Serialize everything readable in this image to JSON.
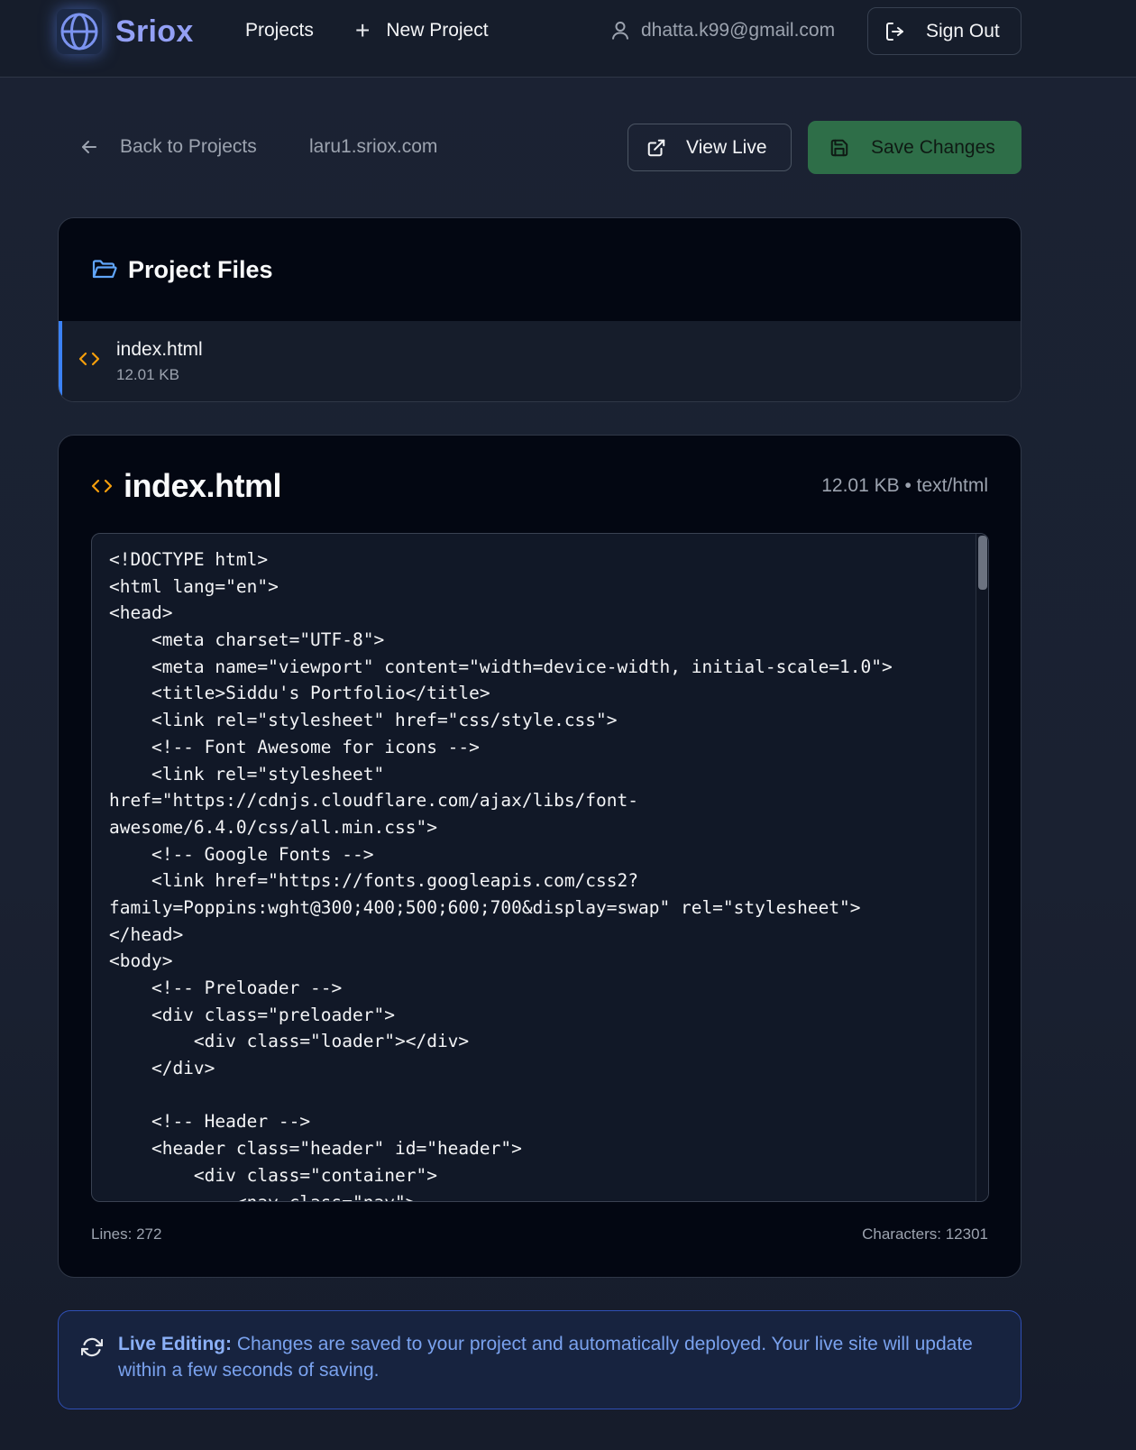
{
  "nav": {
    "brand": "Sriox",
    "projects_label": "Projects",
    "new_project_label": "New Project",
    "user_email": "dhatta.k99@gmail.com",
    "sign_out_label": "Sign Out"
  },
  "toolbar": {
    "back_label": "Back to Projects",
    "domain": "laru1.sriox.com",
    "view_live_label": "View Live",
    "save_label": "Save Changes"
  },
  "files": {
    "title": "Project Files",
    "items": [
      {
        "name": "index.html",
        "size": "12.01 KB",
        "selected": true
      }
    ]
  },
  "editor": {
    "filename": "index.html",
    "meta": "12.01 KB • text/html",
    "lines_label": "Lines: 272",
    "chars_label": "Characters: 12301",
    "scroll_fraction": 0.0,
    "code_lines": [
      "<!DOCTYPE html>",
      "<html lang=\"en\">",
      "<head>",
      "    <meta charset=\"UTF-8\">",
      "    <meta name=\"viewport\" content=\"width=device-width, initial-scale=1.0\">",
      "    <title>Siddu's Portfolio</title>",
      "    <link rel=\"stylesheet\" href=\"css/style.css\">",
      "    <!-- Font Awesome for icons -->",
      "    <link rel=\"stylesheet\"",
      "href=\"https://cdnjs.cloudflare.com/ajax/libs/font-",
      "awesome/6.4.0/css/all.min.css\">",
      "    <!-- Google Fonts -->",
      "    <link href=\"https://fonts.googleapis.com/css2?",
      "family=Poppins:wght@300;400;500;600;700&display=swap\" rel=\"stylesheet\">",
      "</head>",
      "<body>",
      "    <!-- Preloader -->",
      "    <div class=\"preloader\">",
      "        <div class=\"loader\"></div>",
      "    </div>",
      "",
      "    <!-- Header -->",
      "    <header class=\"header\" id=\"header\">",
      "        <div class=\"container\">",
      "            <nav class=\"nav\">"
    ]
  },
  "banner": {
    "title": "Live Editing:",
    "text": " Changes are saved to your project and automatically deployed. Your live site will update within a few seconds of saving."
  },
  "colors": {
    "accent": "#3b82f6",
    "save_green": "#2e6e48",
    "file_icon": "#f59e0b",
    "brand": "#93a0f5"
  }
}
